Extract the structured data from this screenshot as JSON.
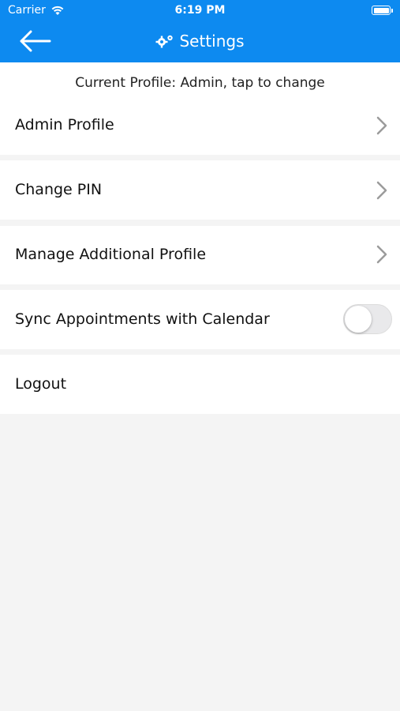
{
  "status_bar": {
    "carrier": "Carrier",
    "time": "6:19 PM"
  },
  "nav": {
    "title": "Settings"
  },
  "profile_banner": "Current Profile: Admin, tap to change",
  "rows": [
    {
      "label": "Admin Profile"
    },
    {
      "label": "Change PIN"
    },
    {
      "label": "Manage Additional Profile"
    },
    {
      "label": "Sync Appointments with Calendar",
      "toggle_on": false
    },
    {
      "label": "Logout"
    }
  ],
  "colors": {
    "header": "#0d8af0",
    "background": "#f4f4f4"
  }
}
